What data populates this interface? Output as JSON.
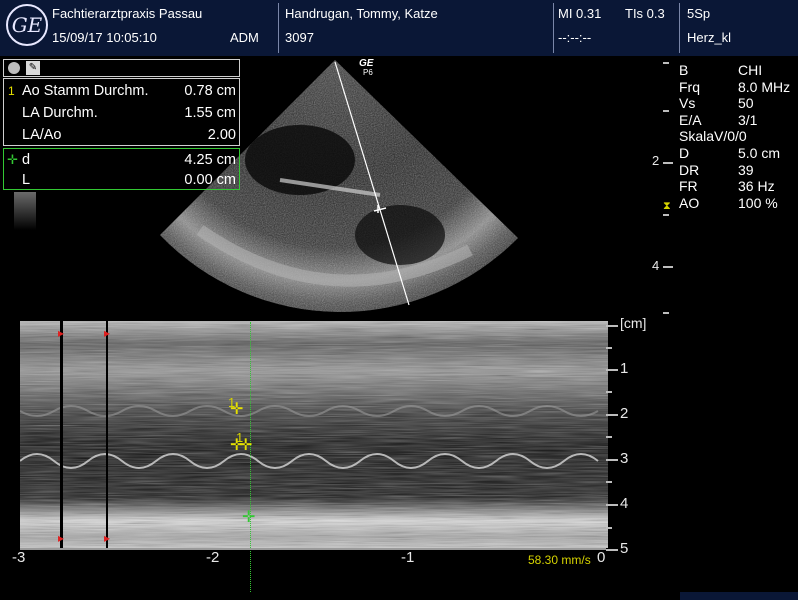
{
  "header": {
    "logo_text": "GE",
    "institution": "Fachtierarztpraxis Passau",
    "datetime": "15/09/17 10:05:10",
    "operator": "ADM",
    "patient": "Handrugan, Tommy, Katze",
    "patient_id": "3097",
    "mi": "MI 0.31",
    "tis": "TIs 0.3",
    "date_placeholder": "--:--:--",
    "probe": "5Sp",
    "preset": "Herz_kl"
  },
  "probe_marker": {
    "logo": "GE",
    "model": "P6"
  },
  "measurements": {
    "toolbar_icons": [
      "record-circle-icon",
      "ruler-tool-icon"
    ],
    "rows": [
      {
        "num": "1",
        "label": "Ao Stamm Durchm.",
        "value": "0.78 cm"
      },
      {
        "num": "",
        "label": "LA Durchm.",
        "value": "1.55 cm"
      },
      {
        "num": "",
        "label": "LA/Ao",
        "value": "2.00"
      }
    ],
    "active_rows": [
      {
        "label": "d",
        "value": "4.25 cm"
      },
      {
        "label": "L",
        "value": "0.00 cm"
      }
    ]
  },
  "params": [
    {
      "label": "B",
      "value": "CHI"
    },
    {
      "label": "Frq",
      "value": "8.0 MHz"
    },
    {
      "label": "Vs",
      "value": "50"
    },
    {
      "label": "E/A",
      "value": "3/1"
    },
    {
      "label": "SkalaV/0/0",
      "value": ""
    },
    {
      "label": "D",
      "value": "5.0 cm"
    },
    {
      "label": "DR",
      "value": "39"
    },
    {
      "label": "FR",
      "value": "36 Hz"
    },
    {
      "label": "AO",
      "value": "100 %"
    }
  ],
  "bmode_scale": {
    "labels": [
      "2",
      "4"
    ]
  },
  "mmode_scale": {
    "unit": "[cm]",
    "labels": [
      "1",
      "2",
      "3",
      "4",
      "5"
    ]
  },
  "time_axis": {
    "labels": [
      "-3",
      "-2",
      "-1",
      "0"
    ],
    "sweep_speed": "58.30 mm/s"
  },
  "caliper_labels": [
    "1",
    "1"
  ],
  "colors": {
    "header": "#0a1736",
    "caliper": "#e6e000",
    "active": "#33c833",
    "marker": "#e02020"
  }
}
